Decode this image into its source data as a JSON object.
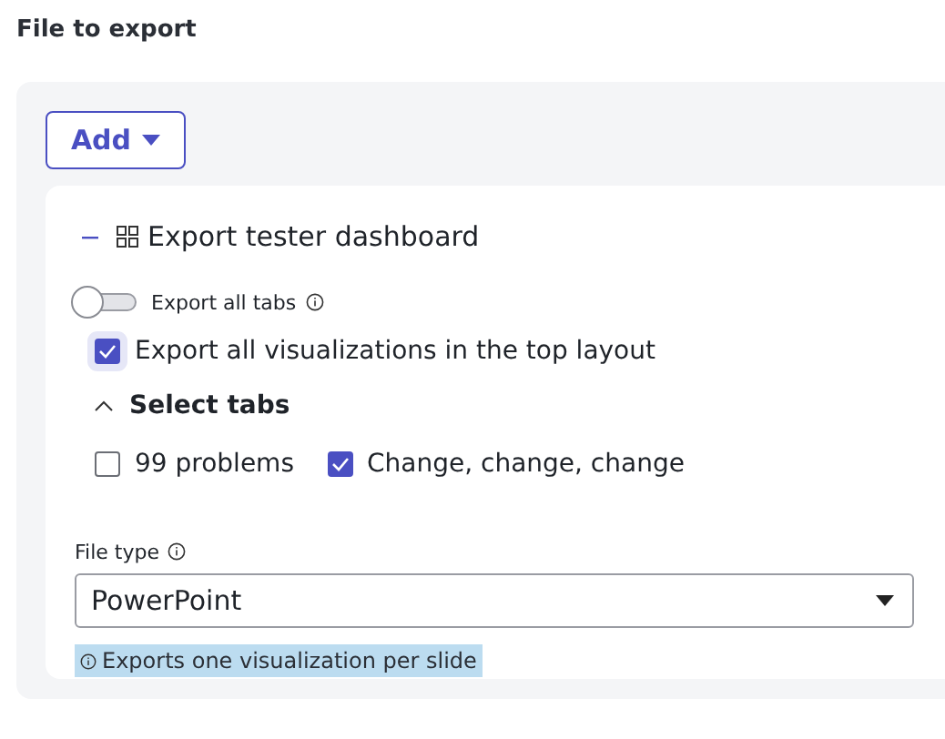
{
  "heading": "File to export",
  "add_button": {
    "label": "Add"
  },
  "dashboard": {
    "expanded": true,
    "title": "Export tester dashboard",
    "export_all_tabs": {
      "label": "Export all tabs",
      "on": false
    },
    "export_all_visualizations": {
      "label": "Export all visualizations in the top layout",
      "checked": true
    },
    "select_tabs": {
      "label": "Select tabs",
      "expanded": true,
      "tabs": [
        {
          "label": "99 problems",
          "checked": false
        },
        {
          "label": "Change, change, change",
          "checked": true
        }
      ]
    }
  },
  "file_type": {
    "label": "File type",
    "value": "PowerPoint",
    "hint": "Exports one visualization per slide"
  }
}
